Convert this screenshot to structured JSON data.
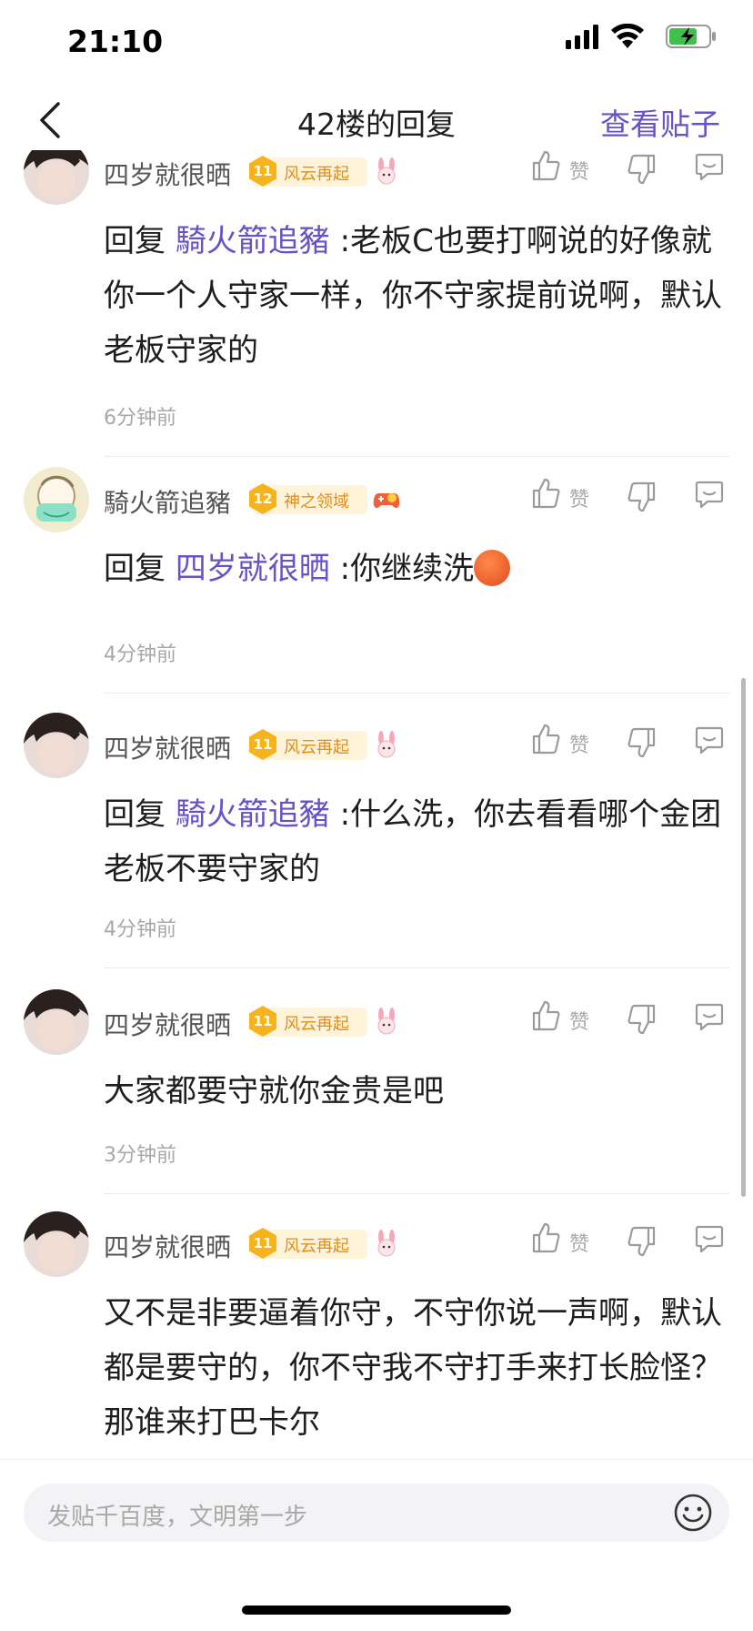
{
  "status_bar": {
    "time": "21:10"
  },
  "nav": {
    "title": "42楼的回复",
    "view_post": "查看贴子"
  },
  "like_label": "赞",
  "replies": [
    {
      "author": "四岁就很晒",
      "level": "11",
      "level_title": "风云再起",
      "prefix": "回复 ",
      "mention": "騎火箭追豬",
      "body": " :老板C也要打啊说的好像就你一个人守家一样，你不守家提前说啊，默认老板守家的",
      "time": "6分钟前"
    },
    {
      "author": "騎火箭追豬",
      "level": "12",
      "level_title": "神之领域",
      "prefix": "回复 ",
      "mention": "四岁就很晒",
      "body": " :你继续洗",
      "time": "4分钟前"
    },
    {
      "author": "四岁就很晒",
      "level": "11",
      "level_title": "风云再起",
      "prefix": "回复 ",
      "mention": "騎火箭追豬",
      "body": " :什么洗，你去看看哪个金团老板不要守家的",
      "time": "4分钟前"
    },
    {
      "author": "四岁就很晒",
      "level": "11",
      "level_title": "风云再起",
      "body": "大家都要守就你金贵是吧",
      "time": "3分钟前"
    },
    {
      "author": "四岁就很晒",
      "level": "11",
      "level_title": "风云再起",
      "body": "又不是非要逼着你守，不守你说一声啊，默认都是要守的，你不守我不守打手来打长脸怪？那谁来打巴卡尔"
    }
  ],
  "input": {
    "placeholder": "发贴千百度，文明第一步"
  },
  "colors": {
    "accent": "#6553c8",
    "badge": "#f7b31c",
    "muted": "#a8a8a8"
  }
}
